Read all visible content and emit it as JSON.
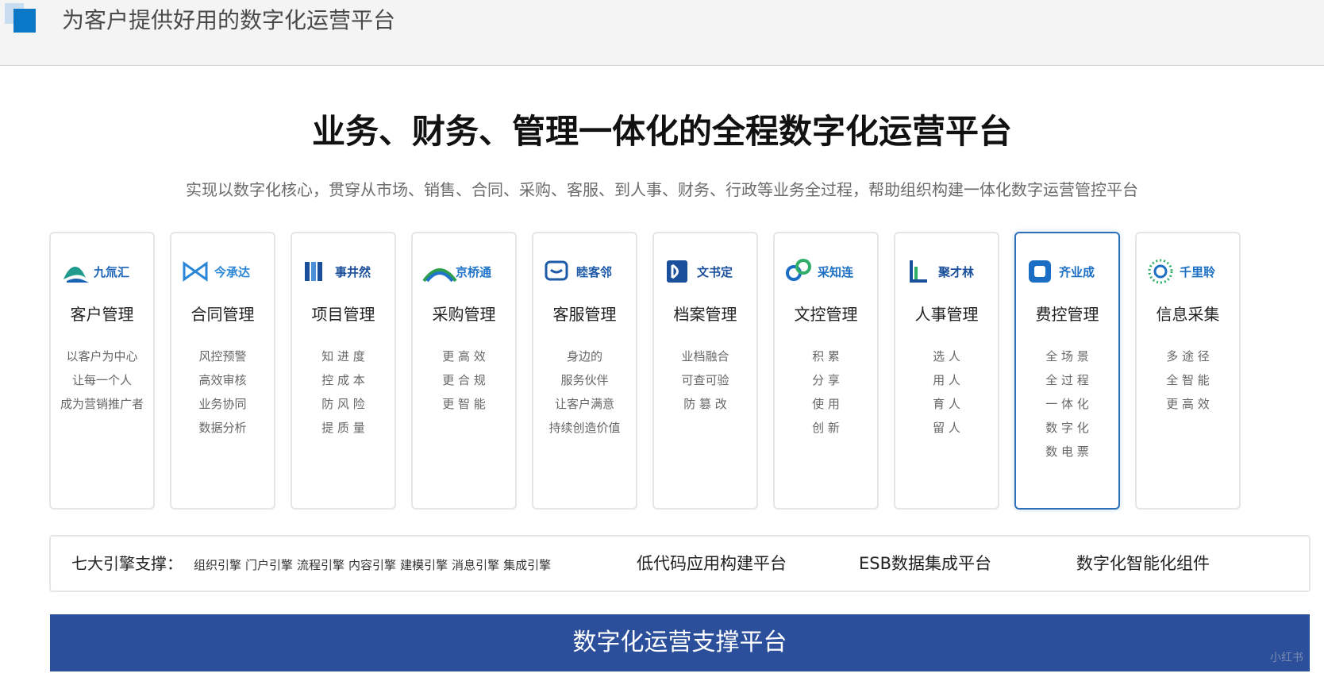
{
  "header": {
    "title": "为客户提供好用的数字化运营平台"
  },
  "main": {
    "title": "业务、财务、管理一体化的全程数字化运营平台",
    "subtitle": "实现以数字化核心，贯穿从市场、销售、合同、采购、客服、到人事、财务、行政等业务全过程，帮助组织构建一体化数字运营管控平台"
  },
  "cards": [
    {
      "brand": "九氚汇",
      "title": "客户管理",
      "lines": [
        "以客户为中心",
        "让每一个人",
        "成为营销推广者"
      ],
      "color": "#1a62b5"
    },
    {
      "brand": "今承达",
      "title": "合同管理",
      "lines": [
        "风控预警",
        "高效审核",
        "业务协同",
        "数据分析"
      ],
      "color": "#2a86d6"
    },
    {
      "brand": "事井然",
      "title": "项目管理",
      "lines": [
        "知 进 度",
        "控 成 本",
        "防 风 险",
        "提 质 量"
      ],
      "color": "#1a4f9c"
    },
    {
      "brand": "京桥通",
      "title": "采购管理",
      "lines": [
        "更 高 效",
        "更 合 规",
        "更 智 能"
      ],
      "color": "#1f73c9"
    },
    {
      "brand": "睦客邻",
      "title": "客服管理",
      "lines": [
        "身边的",
        "服务伙伴",
        "让客户满意",
        "持续创造价值"
      ],
      "color": "#1d5aa8"
    },
    {
      "brand": "文书定",
      "title": "档案管理",
      "lines": [
        "业档融合",
        "可查可验",
        "防 篡 改"
      ],
      "color": "#1a4f9c"
    },
    {
      "brand": "采知连",
      "title": "文控管理",
      "lines": [
        "积  累",
        "分  享",
        "使  用",
        "创  新"
      ],
      "color": "#1a6fc4"
    },
    {
      "brand": "聚才林",
      "title": "人事管理",
      "lines": [
        "选  人",
        "用  人",
        "育  人",
        "留  人"
      ],
      "color": "#1a4f9c"
    },
    {
      "brand": "齐业成",
      "title": "费控管理",
      "lines": [
        "全 场 景",
        "全 过 程",
        "一 体 化",
        "数 字 化",
        "数 电 票"
      ],
      "color": "#1a6fc4"
    },
    {
      "brand": "千里聆",
      "title": "信息采集",
      "lines": [
        "多 途 径",
        "全 智 能",
        "更 高 效"
      ],
      "color": "#1a6fc4"
    }
  ],
  "engines": {
    "label": "七大引擎支撑：",
    "items": [
      "组织引擎",
      "门户引擎",
      "流程引擎",
      "内容引擎",
      "建模引擎",
      "消息引擎",
      "集成引擎"
    ],
    "platforms": [
      "低代码应用构建平台",
      "ESB数据集成平台",
      "数字化智能化组件"
    ]
  },
  "footer": {
    "bar_label": "数字化运营支撑平台"
  },
  "watermark": "小红书"
}
